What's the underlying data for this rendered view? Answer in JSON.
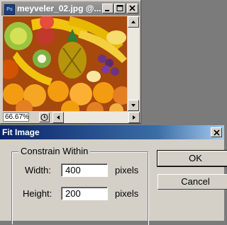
{
  "document_window": {
    "title": "meyveler_02.jpg @...",
    "app_icon": "ps-icon",
    "controls": [
      "minimize-icon",
      "maximize-icon",
      "close-icon"
    ],
    "zoom": "66.67%"
  },
  "dialog": {
    "title": "Fit Image",
    "group_label": "Constrain Within",
    "width_label": "Width:",
    "width_value": "400",
    "width_unit": "pixels",
    "height_label": "Height:",
    "height_value": "200",
    "height_unit": "pixels",
    "ok_label": "OK",
    "cancel_label": "Cancel"
  },
  "colors": {
    "dialog_title": "#0a246a",
    "inactive_title": "#808080",
    "face": "#d4d0c8"
  }
}
